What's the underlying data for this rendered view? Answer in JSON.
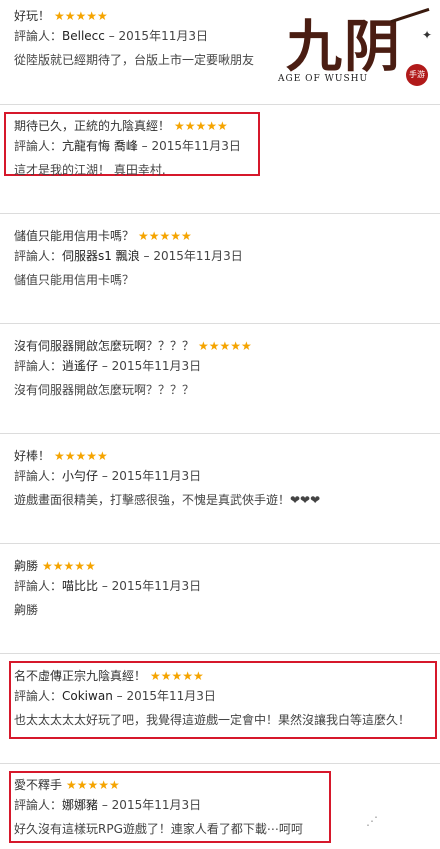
{
  "reviews": [
    {
      "title": "好玩！",
      "stars": "★★★★★",
      "author_prefix": "評論人：",
      "author": "Bellecc",
      "date_sep": " – ",
      "date": "2015年11月3日",
      "body": "從陸版就已經期待了，台版上市一定要啾朋友"
    },
    {
      "title": "期待已久，正統的九陰真經！",
      "stars": "★★★★★",
      "author_prefix": "評論人：",
      "author": "亢龍有悔 喬峰",
      "date_sep": " – ",
      "date": "2015年11月3日",
      "body": "這才是我的江湖！ 真田幸村."
    },
    {
      "title": "儲值只能用信用卡嗎？",
      "stars": "★★★★★",
      "author_prefix": "評論人：",
      "author": "伺服器s1 飄浪",
      "date_sep": " – ",
      "date": "2015年11月3日",
      "body": "儲值只能用信用卡嗎？"
    },
    {
      "title": "沒有伺服器開啟怎麼玩啊？？？？",
      "stars": "★★★★★",
      "author_prefix": "評論人：",
      "author": "逍遙仔",
      "date_sep": " – ",
      "date": "2015年11月3日",
      "body": "沒有伺服器開啟怎麼玩啊？？？？"
    },
    {
      "title": "好棒！",
      "stars": "★★★★★",
      "author_prefix": "評論人：",
      "author": "小勻仔",
      "date_sep": " – ",
      "date": "2015年11月3日",
      "body": "遊戲畫面很精美，打擊感很強，不愧是真武俠手遊！❤❤❤"
    },
    {
      "title": "齁勝",
      "stars": "★★★★★",
      "author_prefix": "評論人：",
      "author": "喵比比",
      "date_sep": " – ",
      "date": "2015年11月3日",
      "body": "齁勝"
    },
    {
      "title": "名不虛傳正宗九陰真經！",
      "stars": "★★★★★",
      "author_prefix": "評論人：",
      "author": "Cokiwan",
      "date_sep": " – ",
      "date": "2015年11月3日",
      "body": "也太太太太太好玩了吧，我覺得這遊戲一定會中！果然沒讓我白等這麼久！"
    },
    {
      "title": "愛不釋手",
      "stars": "★★★★★",
      "author_prefix": "評論人：",
      "author": "娜娜豬",
      "date_sep": " – ",
      "date": "2015年11月3日",
      "body": "好久沒有這樣玩RPG遊戲了！連家人看了都下載⋯呵呵"
    }
  ],
  "logo": {
    "glyph": "九阴",
    "subtitle": "AGE OF WUSHU",
    "stamp": "手游"
  },
  "colors": {
    "star": "#f5a400",
    "highlight": "#d6182b",
    "divider": "#dcdcdc"
  }
}
